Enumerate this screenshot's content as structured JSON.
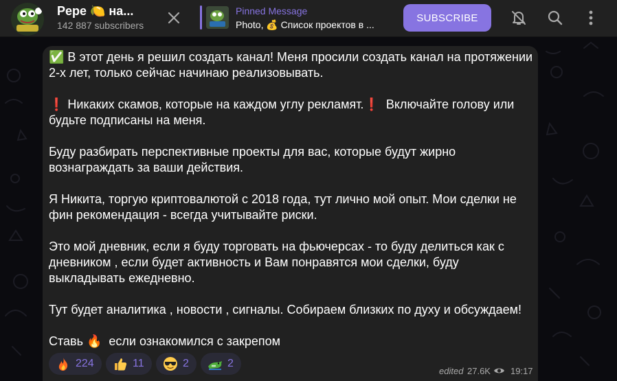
{
  "header": {
    "title": "Pepe 🍋 на...",
    "subscribers": "142 887 subscribers",
    "pinned_label": "Pinned Message",
    "pinned_text": "Photo, 💰 Список проектов в ...",
    "subscribe_label": "SUBSCRIBE"
  },
  "message": {
    "paragraphs": [
      "✅ В этот день я решил создать канал! Меня просили создать канал на протяжении 2-х лет, только сейчас начинаю реализовывать.",
      "❗ Никаких скамов, которые на каждом углу рекламят.❗  Включайте голову или будьте подписаны на меня.",
      "Буду разбирать перспективные проекты для вас, которые будут жирно вознаграждать за ваши действия.",
      "Я Никита, торгую криптовалютой с 2018 года, тут лично мой опыт. Мои сделки не фин рекомендация - всегда учитывайте риски.",
      "Это мой дневник, если я буду торговать на фьючерсах - то буду делиться как с дневником , если будет активность и Вам понравятся мои сделки, буду выкладывать ежедневно.",
      "Тут будет аналитика , новости , сигналы. Собираем близких по духу и обсуждаем!",
      "Ставь 🔥  если ознакомился с закрепом"
    ],
    "reactions": [
      {
        "emoji": "fire-icon",
        "count": "224"
      },
      {
        "emoji": "thumbs-up-icon",
        "count": "11"
      },
      {
        "emoji": "sunglasses-icon",
        "count": "2"
      },
      {
        "emoji": "crocodile-icon",
        "count": "2"
      }
    ],
    "edited_label": "edited",
    "views": "27.6K",
    "time": "19:17"
  },
  "colors": {
    "accent": "#8774e1",
    "bubble": "#212121",
    "header": "#212121",
    "reaction_bg": "#2a2a36",
    "meta_text": "#aaaaaa"
  }
}
